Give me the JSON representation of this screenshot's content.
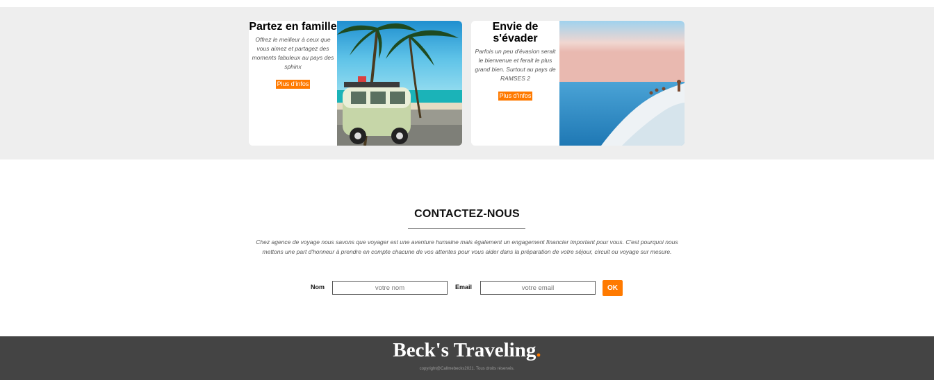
{
  "offers": [
    {
      "title": "Partez en famille",
      "description": "Offrez le meilleur à ceux que vous aimez et partagez des moments fabuleux au pays des sphinx",
      "button_label": "Plus d'infos",
      "image": "beach-van-palm-photo"
    },
    {
      "title": "Envie de s'évader",
      "description": "Parfois un peu d'évasion serait le bienvenue et ferait le plus grand bien. Surtout au pays de RAMSES 2",
      "button_label": "Plus d'infos",
      "image": "white-cliff-sea-photo"
    }
  ],
  "contact": {
    "title": "CONTACTEZ-NOUS",
    "text": "Chez agence de voyage nous savons que voyager est une aventure humaine mais également un engagement financier important pour vous. C'est pourquoi nous mettons une part d'honneur à prendre en compte chacune de vos attentes pour vous aider dans la préparation de votre séjour, circuit ou voyage sur mesure.",
    "name_label": "Nom",
    "name_placeholder": "votre nom",
    "email_label": "Email",
    "email_placeholder": "votre email",
    "submit_label": "OK"
  },
  "footer": {
    "brand": "Beck's Traveling",
    "brand_dot": ".",
    "copyright": "copyright@Callmebecks2021. Tous droits réservés."
  },
  "colors": {
    "accent": "#ff7a00",
    "footer_bg": "#444444",
    "band_bg": "#eeeeee"
  }
}
